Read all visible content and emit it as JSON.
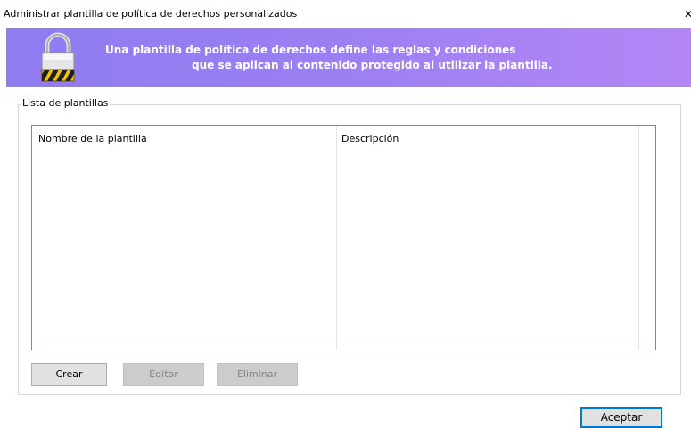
{
  "window": {
    "title": "Administrar plantilla de política de derechos personalizados",
    "close_glyph": "✕"
  },
  "banner": {
    "icon": "lock-icon",
    "line1": "Una plantilla de política de derechos define las reglas y condiciones",
    "line2": "que se aplican al contenido protegido al utilizar la plantilla."
  },
  "templates_group": {
    "legend": "Lista de plantillas",
    "columns": [
      "Nombre de la plantilla",
      "Descripción"
    ],
    "rows": []
  },
  "buttons": {
    "create": "Crear",
    "edit": "Editar",
    "delete": "Eliminar",
    "accept": "Aceptar"
  },
  "colors": {
    "banner_start": "#8f7cf0",
    "banner_end": "#b486f5",
    "focus_border": "#0078d7"
  }
}
